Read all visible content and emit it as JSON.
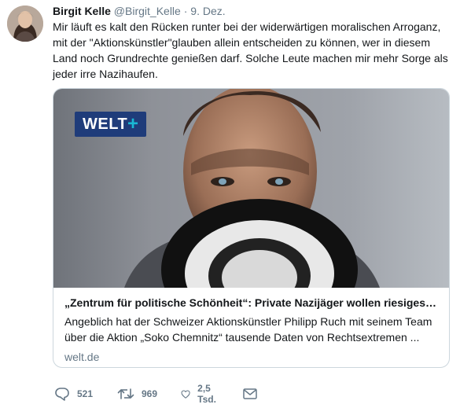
{
  "tweet": {
    "author_name": "Birgit Kelle",
    "author_handle": "@Birgit_Kelle",
    "separator": "·",
    "date": "9. Dez.",
    "text": "Mir läuft es kalt den Rücken runter bei der widerwärtigen moralischen Arroganz, mit der \"Aktionskünstler\"glauben allein entscheiden zu können, wer in diesem Land noch Grundrechte genießen darf. Solche Leute machen mir mehr Sorge als jeder irre Nazihaufen."
  },
  "card": {
    "logo_text": "WELT",
    "logo_plus": "+",
    "title": "„Zentrum für politische Schönheit“: Private Nazijäger wollen riesiges N...",
    "description": "Angeblich hat der Schweizer Aktionskünstler Philipp Ruch mit seinem Team über die Aktion „Soko Chemnitz“ tausende Daten von Rechtsextremen ...",
    "domain": "welt.de"
  },
  "actions": {
    "reply_count": "521",
    "retweet_count": "969",
    "like_count": "2,5 Tsd."
  },
  "icons": {
    "reply": "reply-icon",
    "retweet": "retweet-icon",
    "like": "heart-icon",
    "dm": "envelope-icon"
  },
  "colors": {
    "text": "#14171a",
    "muted": "#657786",
    "border": "#ccd6dd",
    "logo_bg": "#1f3c7a",
    "logo_plus": "#19b8d4"
  }
}
